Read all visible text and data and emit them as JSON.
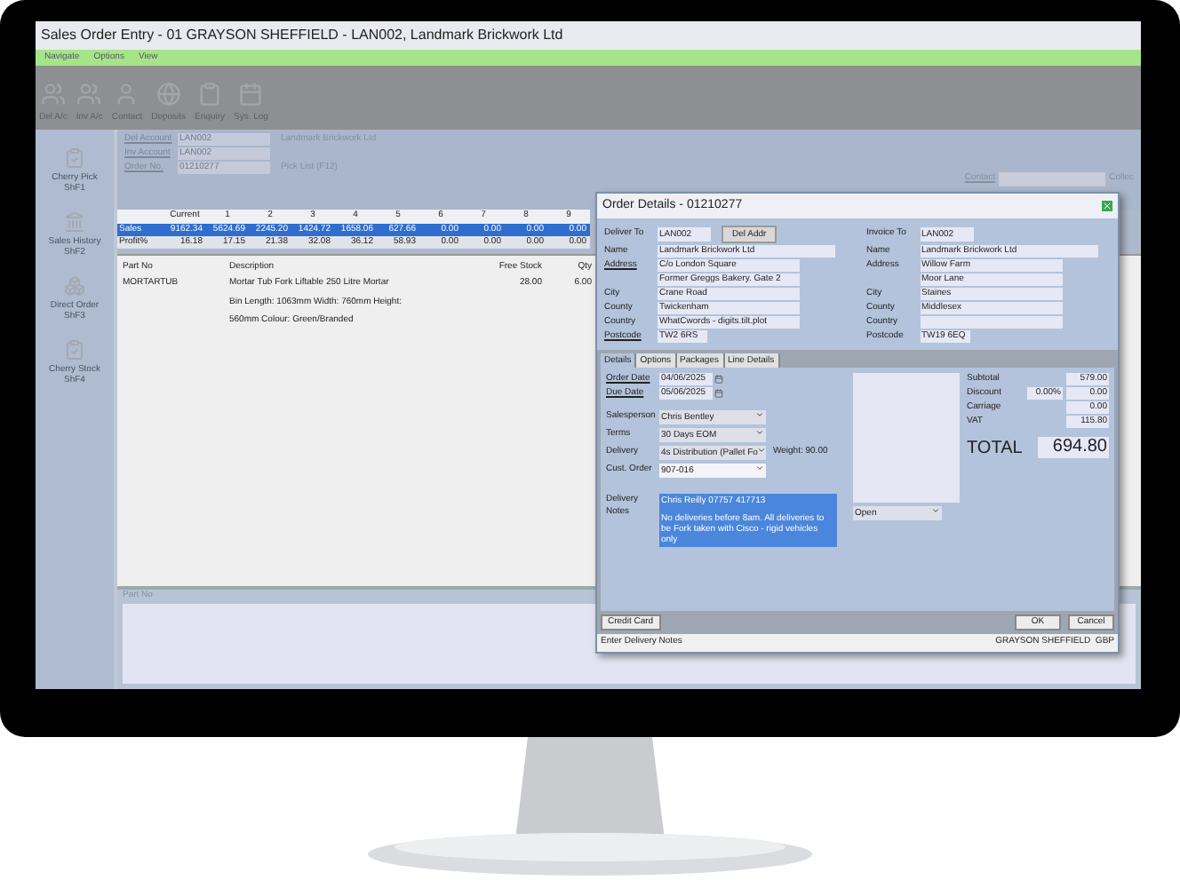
{
  "window": {
    "title": "Sales Order Entry - 01 GRAYSON SHEFFIELD - LAN002, Landmark Brickwork Ltd"
  },
  "menu": [
    "Navigate",
    "Options",
    "View"
  ],
  "toolbar": [
    {
      "label": "Del A/c"
    },
    {
      "label": "Inv A/c"
    },
    {
      "label": "Contact"
    },
    {
      "label": "Deposits"
    },
    {
      "label": "Enquiry"
    },
    {
      "label": "Sys. Log"
    }
  ],
  "sidebar": [
    {
      "label": "Cherry Pick",
      "shortcut": "ShF1"
    },
    {
      "label": "Sales History",
      "shortcut": "ShF2"
    },
    {
      "label": "Direct Order",
      "shortcut": "ShF3"
    },
    {
      "label": "Cherry Stock",
      "shortcut": "ShF4"
    }
  ],
  "header": {
    "fields": [
      {
        "label": "Del Account",
        "value": "LAN002"
      },
      {
        "label": "Inv Account",
        "value": "LAN002"
      },
      {
        "label": "Order No.",
        "value": "01210277"
      }
    ],
    "account_name": "Landmark Brickwork Ltd",
    "pick_list": "Pick List (F12)",
    "contact_label": "Contact",
    "collect_label": "Collec"
  },
  "sales_grid": {
    "columns": [
      "Current",
      "1",
      "2",
      "3",
      "4",
      "5",
      "6",
      "7",
      "8",
      "9"
    ],
    "rows": [
      {
        "label": "Sales",
        "selected": true,
        "values": [
          "9162.34",
          "5624.69",
          "2245.20",
          "1424.72",
          "1658.06",
          "627.66",
          "0.00",
          "0.00",
          "0.00",
          "0.00"
        ]
      },
      {
        "label": "Profit%",
        "selected": false,
        "values": [
          "16.18",
          "17.15",
          "21.38",
          "32.08",
          "36.12",
          "58.93",
          "0.00",
          "0.00",
          "0.00",
          "0.00"
        ]
      }
    ]
  },
  "lines": {
    "columns": [
      "Part No",
      "Description",
      "Free Stock",
      "Qty"
    ],
    "rows": [
      {
        "part_no": "MORTARTUB",
        "description": [
          "Mortar Tub Fork Liftable 250 Litre Mortar",
          "Bin Length: 1063mm Width: 760mm Height:",
          "560mm Colour: Green/Branded"
        ],
        "free_stock": "28.00",
        "qty": "6.00"
      }
    ]
  },
  "part_panel": {
    "label": "Part No"
  },
  "dialog": {
    "title": "Order Details - 01210277",
    "deliver": {
      "label": "Deliver To",
      "code": "LAN002",
      "button": "Del Addr",
      "rows": [
        {
          "label": "Name",
          "value": "Landmark Brickwork Ltd",
          "link": false,
          "kind": "wide"
        },
        {
          "label": "Address",
          "value": "C/o London Square",
          "link": true,
          "kind": "normal"
        },
        {
          "value": "Former Greggs Bakery. Gate 2",
          "kind": "normal"
        },
        {
          "label": "City",
          "value": "Crane Road",
          "link": false,
          "kind": "normal"
        },
        {
          "label": "County",
          "value": "Twickenham",
          "link": false,
          "kind": "normal"
        },
        {
          "label": "Country",
          "value": "WhatCwords - digits.tilt.plot",
          "link": false,
          "kind": "normal"
        },
        {
          "label": "Postcode",
          "value": "TW2 6RS",
          "link": true,
          "kind": "short"
        }
      ]
    },
    "invoice": {
      "label": "Invoice To",
      "code": "LAN002",
      "rows": [
        {
          "label": "Name",
          "value": "Landmark Brickwork Ltd",
          "link": false,
          "kind": "wide"
        },
        {
          "label": "Address",
          "value": "Willow Farm",
          "link": false,
          "kind": "normal"
        },
        {
          "value": "Moor Lane",
          "kind": "normal"
        },
        {
          "label": "City",
          "value": "Staines",
          "link": false,
          "kind": "normal"
        },
        {
          "label": "County",
          "value": "Middlesex",
          "link": false,
          "kind": "normal"
        },
        {
          "label": "Country",
          "link": false,
          "kind": "normal"
        },
        {
          "label": "Postcode",
          "value": "TW19 6EQ",
          "link": false,
          "kind": "short"
        }
      ]
    },
    "tabs": [
      {
        "label": "Details",
        "selected": true
      },
      {
        "label": "Options",
        "selected": false
      },
      {
        "label": "Packages",
        "selected": false
      },
      {
        "label": "Line Details",
        "selected": false
      }
    ],
    "details": [
      {
        "kind": "date",
        "label": "Order Date",
        "value": "04/06/2025",
        "link": true
      },
      {
        "kind": "date",
        "label": "Due Date",
        "value": "05/06/2025",
        "link": true
      },
      {
        "kind": "select",
        "label": "Salesperson",
        "value": "Chris Bentley",
        "link": false
      },
      {
        "kind": "select",
        "label": "Terms",
        "value": "30 Days EOM",
        "link": false
      },
      {
        "kind": "select",
        "label": "Delivery",
        "value": "4s Distribution (Pallet Fo",
        "link": false
      },
      {
        "kind": "combo",
        "label": "Cust. Order",
        "value": "907-016",
        "link": false
      }
    ],
    "weight": "Weight: 90.00",
    "notes": {
      "label": "Delivery Notes",
      "selected": true,
      "lines": [
        "Chris Reilly 07757 417713",
        "No deliveries before 8am. All deliveries to be Fork taken with Cisco - rigid vehicles only"
      ]
    },
    "status": "Open",
    "totals": [
      {
        "label": "Subtotal",
        "value": "579.00"
      },
      {
        "label": "Discount",
        "percent": "0.00%",
        "value": "0.00"
      },
      {
        "label": "Carriage",
        "value": "0.00"
      },
      {
        "label": "VAT",
        "value": "115.80"
      }
    ],
    "total": {
      "label": "TOTAL",
      "value": "694.80"
    },
    "buttons": {
      "left": "Credit Card",
      "ok": "OK",
      "cancel": "Cancel"
    },
    "status_bar": {
      "left": "Enter Delivery Notes",
      "right": "GRAYSON SHEFFIELD  GBP"
    }
  }
}
